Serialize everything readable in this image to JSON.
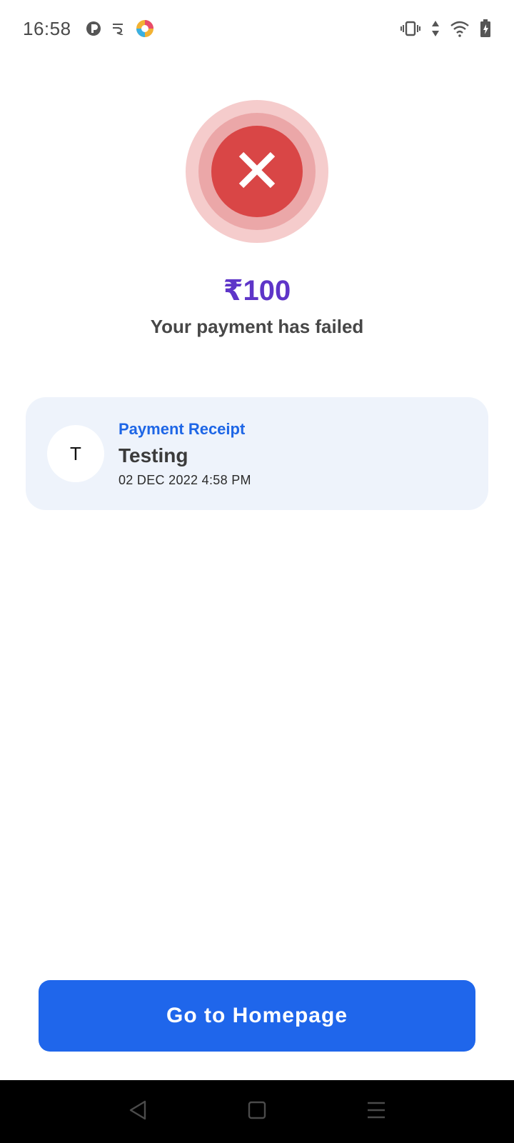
{
  "status_bar": {
    "time": "16:58",
    "left_icons": [
      "pocket-icon",
      "rupee-app-icon",
      "colorful-app-icon"
    ],
    "right_icons": [
      "vibrate-icon",
      "data-arrows-icon",
      "wifi-icon",
      "battery-charging-icon"
    ]
  },
  "payment": {
    "amount": "₹100",
    "status_message": "Your payment has failed",
    "status_icon": "close-icon",
    "accent_color": "#d94646"
  },
  "receipt": {
    "label": "Payment Receipt",
    "avatar_initial": "T",
    "name": "Testing",
    "datetime": "02 DEC 2022 4:58 PM"
  },
  "actions": {
    "home_button_label": "Go to Homepage",
    "button_color": "#1f66eb"
  },
  "nav_bar": {
    "buttons": [
      "back-icon",
      "home-icon",
      "menu-icon"
    ]
  }
}
